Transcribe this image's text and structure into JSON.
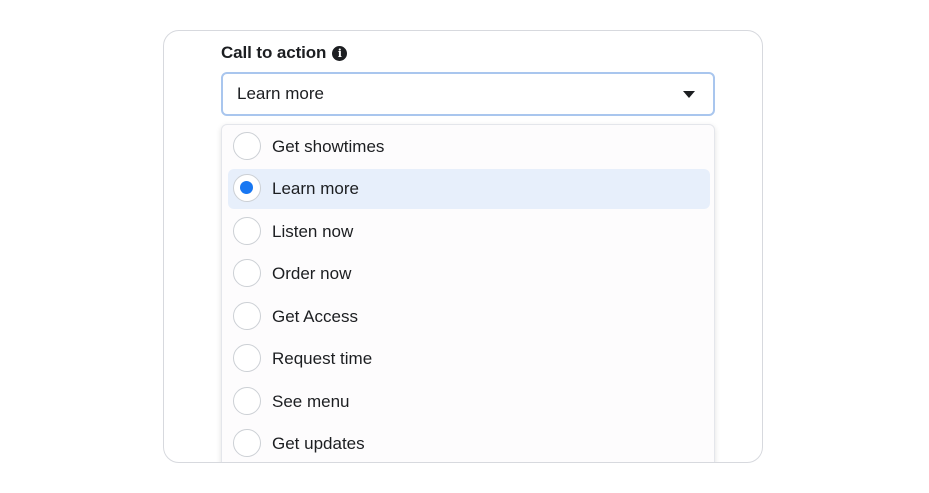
{
  "field": {
    "label": "Call to action",
    "selected_value": "Learn more"
  },
  "icons": {
    "info": "info-icon",
    "caret": "caret-down-icon"
  },
  "colors": {
    "accent": "#1877f2",
    "selected_bg": "#e7effb",
    "focus_border": "#a9c6ee"
  },
  "options": [
    {
      "label": "Get showtimes",
      "selected": false
    },
    {
      "label": "Learn more",
      "selected": true
    },
    {
      "label": "Listen now",
      "selected": false
    },
    {
      "label": "Order now",
      "selected": false
    },
    {
      "label": "Get Access",
      "selected": false
    },
    {
      "label": "Request time",
      "selected": false
    },
    {
      "label": "See menu",
      "selected": false
    },
    {
      "label": "Get updates",
      "selected": false
    }
  ]
}
